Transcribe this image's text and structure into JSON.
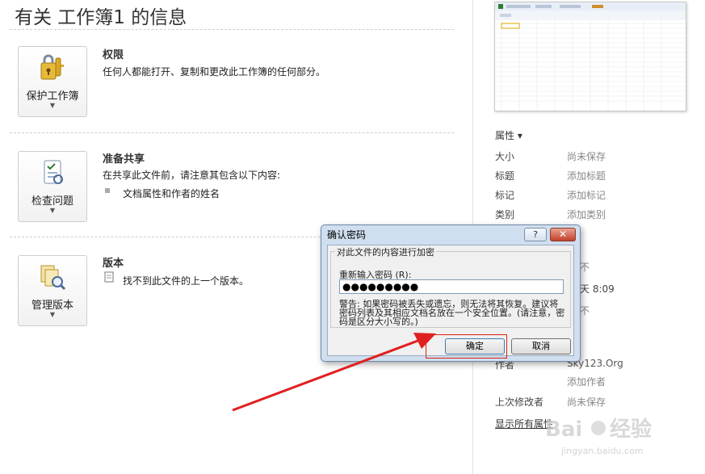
{
  "page": {
    "title": "有关 工作簿1 的信息"
  },
  "sections": {
    "permissions": {
      "button_label": "保护工作簿",
      "title": "权限",
      "text": "任何人都能打开、复制和更改此工作簿的任何部分。"
    },
    "prepare": {
      "button_label": "检查问题",
      "title": "准备共享",
      "text": "在共享此文件前，请注意其包含以下内容:",
      "bullet": "文档属性和作者的姓名"
    },
    "versions": {
      "button_label": "管理版本",
      "title": "版本",
      "text": "找不到此文件的上一个版本。"
    }
  },
  "properties": {
    "header": "属性 ▾",
    "rows": [
      {
        "label": "大小",
        "value": "尚未保存"
      },
      {
        "label": "标题",
        "value": "添加标题"
      },
      {
        "label": "标记",
        "value": "添加标记"
      },
      {
        "label": "类别",
        "value": "添加类别"
      }
    ],
    "partial_values": [
      "不",
      "天 8:09",
      "不"
    ],
    "author_label": "作者",
    "author_value": "Sky123.Org",
    "add_author": "添加作者",
    "last_modified_label": "上次修改者",
    "last_modified_value": "尚未保存",
    "show_all": "显示所有属性"
  },
  "dialog": {
    "title": "确认密码",
    "help": "?",
    "close": "✕",
    "group_legend": "对此文件的内容进行加密",
    "field_label": "重新输入密码 (R):",
    "password_value": "●●●●●●●●●",
    "warning": "警告: 如果密码被丢失或遗忘，则无法将其恢复。建议将密码列表及其相应文档名放在一个安全位置。(请注意，密码是区分大小写的。)",
    "ok_label": "确定",
    "cancel_label": "取消"
  },
  "watermark": {
    "brand": "Baidu经验",
    "url": "jingyan.baidu.com"
  },
  "colors": {
    "accent": "#3c7fb1",
    "arrow": "#e02020",
    "highlight_box": "#d21"
  }
}
